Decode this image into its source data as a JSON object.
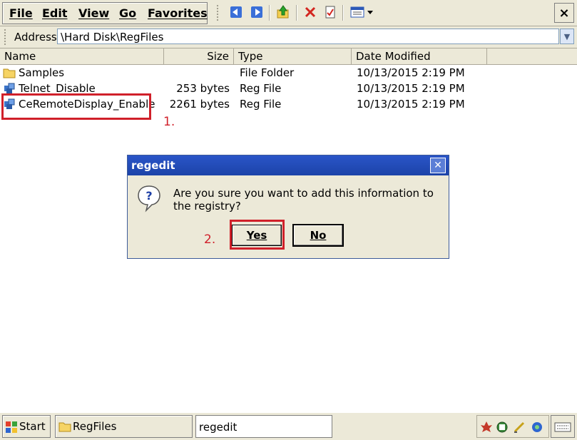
{
  "menubar": {
    "items": [
      "File",
      "Edit",
      "View",
      "Go",
      "Favorites"
    ],
    "toolbar_icons": [
      "back-arrow-icon",
      "forward-arrow-icon",
      "up-folder-icon",
      "delete-icon",
      "properties-icon",
      "views-icon"
    ],
    "close_label": "×"
  },
  "address": {
    "label": "Address",
    "value": "\\Hard Disk\\RegFiles"
  },
  "list": {
    "columns": [
      "Name",
      "Size",
      "Type",
      "Date Modified"
    ],
    "rows": [
      {
        "name": "Samples",
        "size": "",
        "type": "File Folder",
        "date": "10/13/2015 2:19 PM",
        "icon": "folder-icon"
      },
      {
        "name": "Telnet_Disable",
        "size": "253 bytes",
        "type": "Reg File",
        "date": "10/13/2015 2:19 PM",
        "icon": "reg-file-icon"
      },
      {
        "name": "CeRemoteDisplay_Enable",
        "size": "2261 bytes",
        "type": "Reg File",
        "date": "10/13/2015 2:19 PM",
        "icon": "reg-file-icon"
      }
    ]
  },
  "annotations": {
    "step1": "1.",
    "step2": "2.",
    "highlight_color": "#d0202a"
  },
  "dialog": {
    "title": "regedit",
    "message": "Are you sure you want to add this information to the registry?",
    "yes_label": "Yes",
    "no_label": "No",
    "icon": "question-icon"
  },
  "taskbar": {
    "start_label": "Start",
    "window_label": "RegFiles",
    "input_value": "regedit",
    "tray_icons": [
      "leaf-icon",
      "network-icon",
      "pen-icon",
      "connection-icon"
    ],
    "keyboard_icon": "keyboard-icon"
  },
  "colors": {
    "title_bar": "#1c43a8",
    "chrome": "#ece9d8"
  }
}
